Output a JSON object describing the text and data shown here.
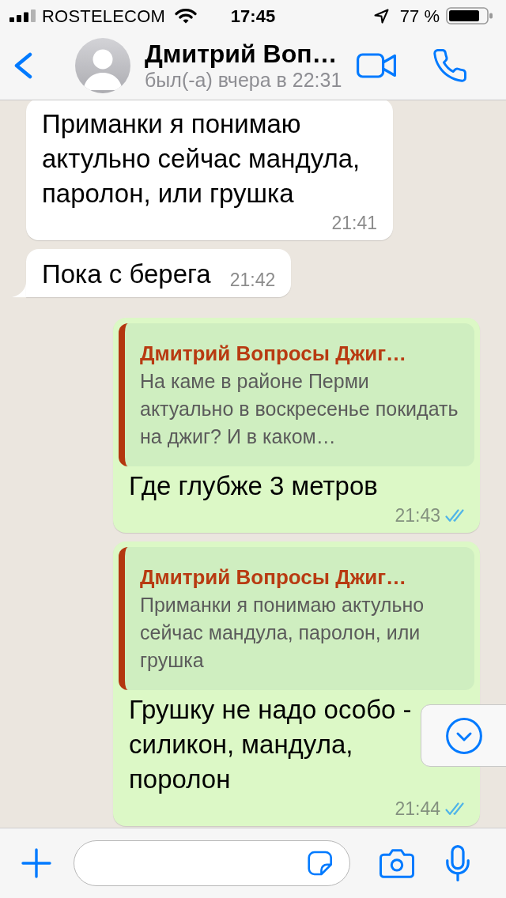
{
  "status_bar": {
    "carrier": "ROSTELECOM",
    "time": "17:45",
    "battery": "77 %"
  },
  "header": {
    "contact_name": "Дмитрий Воп…",
    "last_seen": "был(-а) вчера в 22:31"
  },
  "messages": [
    {
      "kind": "incoming",
      "text": "Приманки я понимаю актульно сейчас мандула, паролон, или грушка",
      "time": "21:41",
      "tail": false
    },
    {
      "kind": "incoming",
      "text": "Пока с берега",
      "time": "21:42",
      "tail": true
    },
    {
      "kind": "outgoing",
      "quote": {
        "sender": "Дмитрий Вопросы Джиг…",
        "text": "На каме в районе Перми актуально в воскресенье покидать на джиг? И в каком…"
      },
      "text": "Где глубже 3 метров",
      "time": "21:43",
      "tail": false,
      "read": true
    },
    {
      "kind": "outgoing",
      "quote": {
        "sender": "Дмитрий Вопросы Джиг…",
        "text": "Приманки я понимаю актульно сейчас мандула, паролон, или грушка"
      },
      "text": "Грушку не надо особо - силикон, мандула, поролон",
      "time": "21:44",
      "tail": false,
      "read": true
    }
  ]
}
